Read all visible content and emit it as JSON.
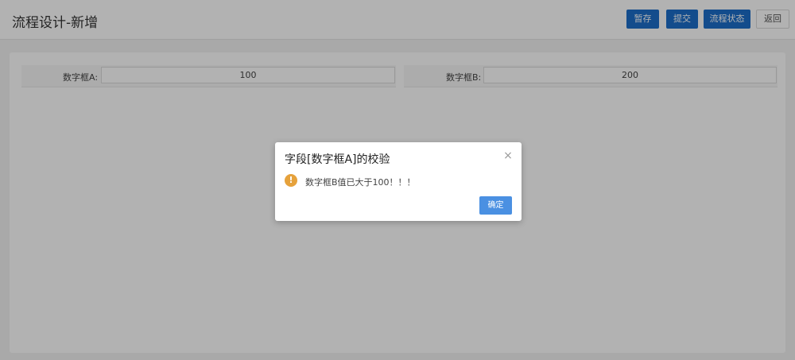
{
  "header": {
    "title": "流程设计-新增",
    "buttons": {
      "save": "暂存",
      "submit": "提交",
      "status": "流程状态",
      "back": "返回"
    }
  },
  "form": {
    "field_a": {
      "label": "数字框A:",
      "value": "100"
    },
    "field_b": {
      "label": "数字框B:",
      "value": "200"
    }
  },
  "dialog": {
    "title": "字段[数字框A]的校验",
    "icon": "warning-icon",
    "message": "数字框B值已大于100！！！",
    "ok_label": "确定",
    "close_glyph": "×"
  },
  "colors": {
    "primary": "#1c6ec9",
    "dialog_ok": "#4a90e2",
    "warning": "#e6a23c"
  }
}
